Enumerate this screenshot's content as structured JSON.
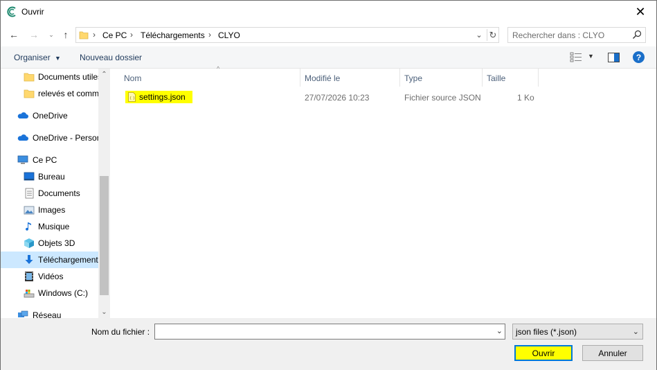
{
  "window": {
    "title": "Ouvrir"
  },
  "address": {
    "crumbs": [
      "Ce PC",
      "Téléchargements",
      "CLYO"
    ]
  },
  "search": {
    "placeholder": "Rechercher dans : CLYO"
  },
  "toolbar": {
    "organize_label": "Organiser",
    "new_folder_label": "Nouveau dossier"
  },
  "sidebar": {
    "items": [
      {
        "label": "Documents utiles",
        "icon": "folder-icon"
      },
      {
        "label": "relevés et comm",
        "icon": "folder-icon"
      },
      {
        "label": "OneDrive",
        "icon": "cloud-icon"
      },
      {
        "label": "OneDrive - Person",
        "icon": "cloud-icon"
      },
      {
        "label": "Ce PC",
        "icon": "computer-icon"
      },
      {
        "label": "Bureau",
        "icon": "desktop-icon"
      },
      {
        "label": "Documents",
        "icon": "documents-icon"
      },
      {
        "label": "Images",
        "icon": "images-icon"
      },
      {
        "label": "Musique",
        "icon": "music-icon"
      },
      {
        "label": "Objets 3D",
        "icon": "3d-objects-icon"
      },
      {
        "label": "Téléchargements",
        "icon": "downloads-icon",
        "selected": true
      },
      {
        "label": "Vidéos",
        "icon": "videos-icon"
      },
      {
        "label": "Windows (C:)",
        "icon": "drive-icon"
      },
      {
        "label": "Réseau",
        "icon": "network-icon"
      }
    ]
  },
  "columns": {
    "name": "Nom",
    "modified": "Modifié le",
    "type": "Type",
    "size": "Taille"
  },
  "files": [
    {
      "name": "settings.json",
      "modified": "27/07/2026 10:23",
      "type": "Fichier source JSON",
      "size": "1 Ko"
    }
  ],
  "bottom": {
    "filename_label": "Nom du fichier :",
    "filename_value": "",
    "filter_value": "json files (*.json)",
    "open_label": "Ouvrir",
    "cancel_label": "Annuler"
  },
  "colors": {
    "highlight": "#ffff00",
    "selection": "#cce8ff",
    "accent": "#0078d7"
  }
}
